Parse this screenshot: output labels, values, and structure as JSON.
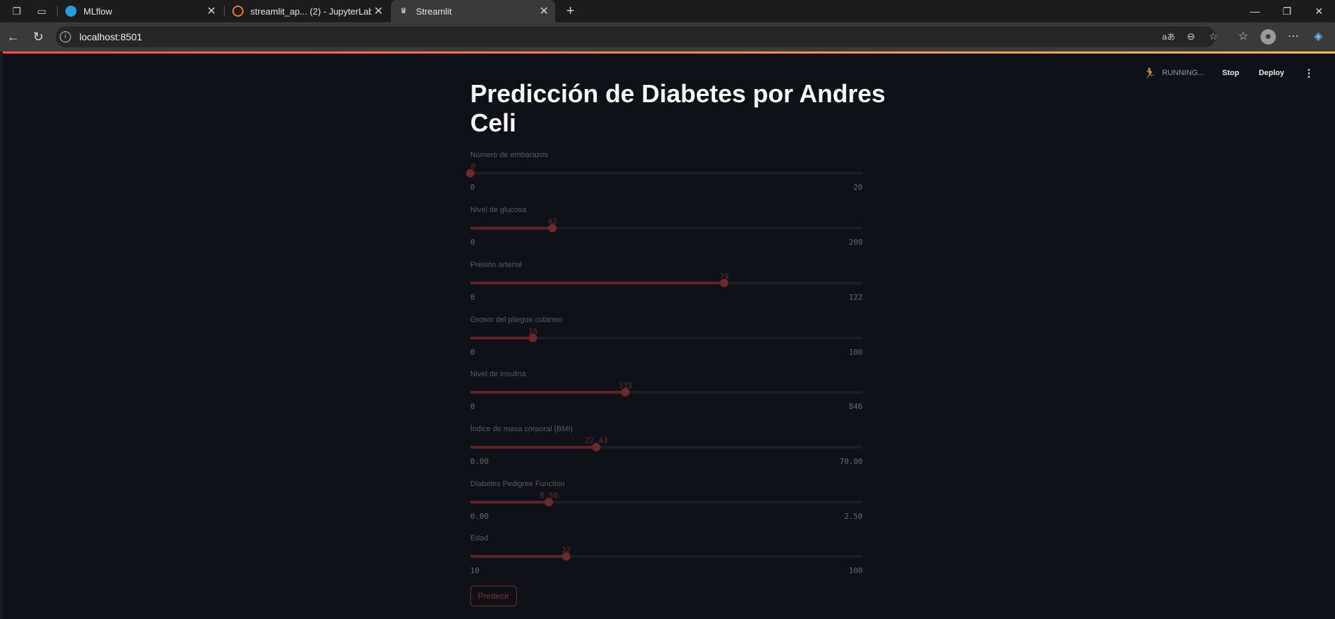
{
  "browser": {
    "tabs": [
      {
        "label": "MLflow",
        "icon": "mlflow-icon",
        "active": false
      },
      {
        "label": "streamlit_ap... (2) - JupyterLab",
        "icon": "jupyter-icon",
        "active": false
      },
      {
        "label": "Streamlit",
        "icon": "streamlit-icon",
        "active": true
      }
    ],
    "url": "localhost:8501"
  },
  "header": {
    "status": "RUNNING...",
    "stop_label": "Stop",
    "deploy_label": "Deploy"
  },
  "main": {
    "title": "Predicción de Diabetes por Andres Celi",
    "sliders": [
      {
        "label": "Número de embarazos",
        "value": "0",
        "min": "0",
        "max": "20",
        "fraction": 0.0
      },
      {
        "label": "Nivel de glucosa",
        "value": "42",
        "min": "0",
        "max": "200",
        "fraction": 0.21
      },
      {
        "label": "Presión arterial",
        "value": "79",
        "min": "0",
        "max": "122",
        "fraction": 0.6475
      },
      {
        "label": "Grosor del pliegue cutáneo",
        "value": "16",
        "min": "0",
        "max": "100",
        "fraction": 0.16
      },
      {
        "label": "Nivel de insulina",
        "value": "335",
        "min": "0",
        "max": "846",
        "fraction": 0.396
      },
      {
        "label": "Índice de masa corporal (BMI)",
        "value": "22.43",
        "min": "0.00",
        "max": "70.00",
        "fraction": 0.3204
      },
      {
        "label": "Diabetes Pedigree Function",
        "value": "0.50",
        "min": "0.00",
        "max": "2.50",
        "fraction": 0.2
      },
      {
        "label": "Edad",
        "value": "32",
        "min": "10",
        "max": "100",
        "fraction": 0.2444
      }
    ],
    "predict_label": "Predecir"
  },
  "colors": {
    "accent": "#ff4b4b",
    "background": "#0e1117"
  }
}
